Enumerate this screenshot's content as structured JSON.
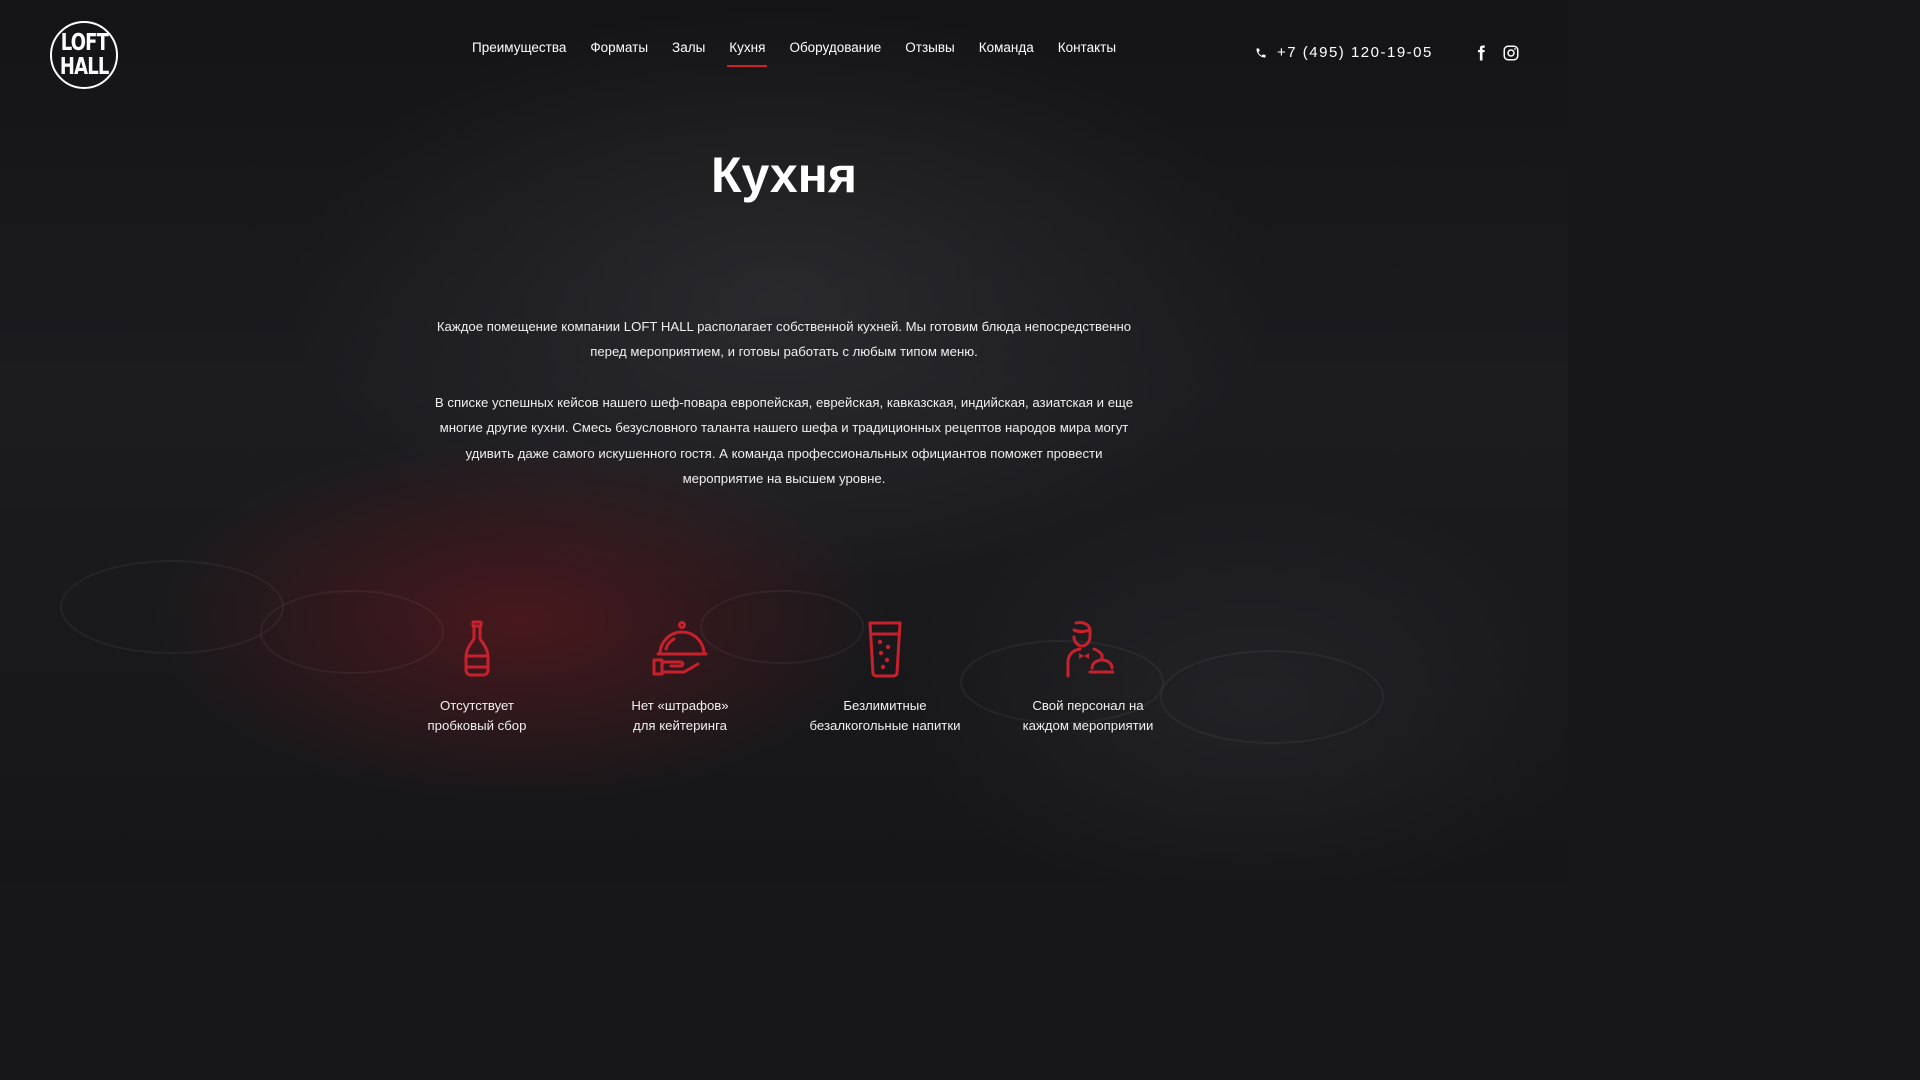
{
  "header": {
    "logo_line1": "LOFT",
    "logo_line2": "HALL",
    "nav": [
      {
        "label": "Преимущества"
      },
      {
        "label": "Форматы"
      },
      {
        "label": "Залы"
      },
      {
        "label": "Кухня",
        "active": true
      },
      {
        "label": "Оборудование"
      },
      {
        "label": "Отзывы"
      },
      {
        "label": "Команда"
      },
      {
        "label": "Контакты"
      }
    ],
    "phone": "+7 (495) 120-19-05",
    "social": [
      "facebook-icon",
      "instagram-icon"
    ]
  },
  "main": {
    "title": "Кухня",
    "paragraph1": "Каждое помещение компании LOFT HALL располагает собственной кухней. Мы готовим блюда непосредственно перед мероприятием, и готовы работать с любым типом меню.",
    "paragraph2": "В списке успешных кейсов нашего шеф-повара европейская, еврейская, кавказская, индийская, азиатская и еще многие другие кухни. Смесь безусловного таланта нашего шефа и традиционных рецептов народов мира могут удивить даже самого искушенного гостя. А команда профессиональных официантов поможет провести мероприятие на высшем уровне."
  },
  "features": [
    {
      "icon": "bottle-icon",
      "label": "Отсутствует\nпробковый сбор"
    },
    {
      "icon": "cloche-icon",
      "label": "Нет «штрафов»\nдля кейтеринга"
    },
    {
      "icon": "drink-glass-icon",
      "label": "Безлимитные\nбезалкогольные напитки"
    },
    {
      "icon": "waiter-icon",
      "label": "Свой персонал на\nкаждом мероприятии"
    }
  ],
  "colors": {
    "accent": "#d0202e",
    "background": "#17171a",
    "text": "#ffffff"
  }
}
